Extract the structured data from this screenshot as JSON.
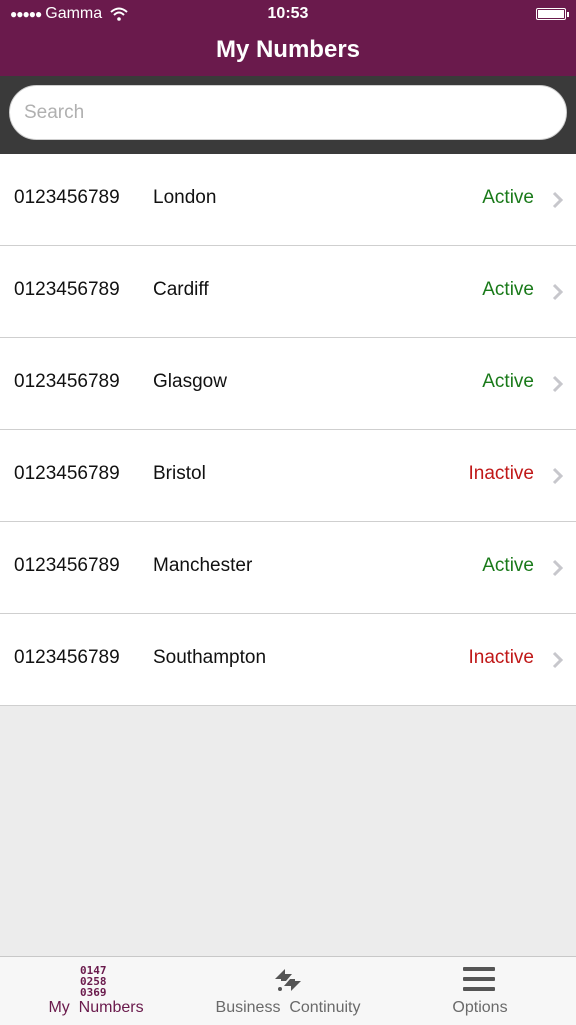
{
  "status_bar": {
    "carrier": "Gamma",
    "time": "10:53"
  },
  "header": {
    "title": "My Numbers"
  },
  "search": {
    "placeholder": "Search"
  },
  "numbers": [
    {
      "number": "0123456789",
      "location": "London",
      "status": "Active",
      "status_color": "#1a7a1a"
    },
    {
      "number": "0123456789",
      "location": "Cardiff",
      "status": "Active",
      "status_color": "#1a7a1a"
    },
    {
      "number": "0123456789",
      "location": "Glasgow",
      "status": "Active",
      "status_color": "#1a7a1a"
    },
    {
      "number": "0123456789",
      "location": "Bristol",
      "status": "Inactive",
      "status_color": "#c01818"
    },
    {
      "number": "0123456789",
      "location": "Manchester",
      "status": "Active",
      "status_color": "#1a7a1a"
    },
    {
      "number": "0123456789",
      "location": "Southampton",
      "status": "Inactive",
      "status_color": "#c01818"
    }
  ],
  "tabbar": {
    "my_numbers": {
      "label": "My  Numbers",
      "icon_lines": [
        "0147",
        "0258",
        "0369"
      ],
      "icon": "numbers-grid-icon"
    },
    "business_continuity": {
      "label": "Business  Continuity",
      "icon": "continuity-arrows-icon"
    },
    "options": {
      "label": "Options",
      "icon": "menu-icon"
    }
  },
  "colors": {
    "brand": "#6a1a4c",
    "active": "#1a7a1a",
    "inactive": "#c01818"
  }
}
